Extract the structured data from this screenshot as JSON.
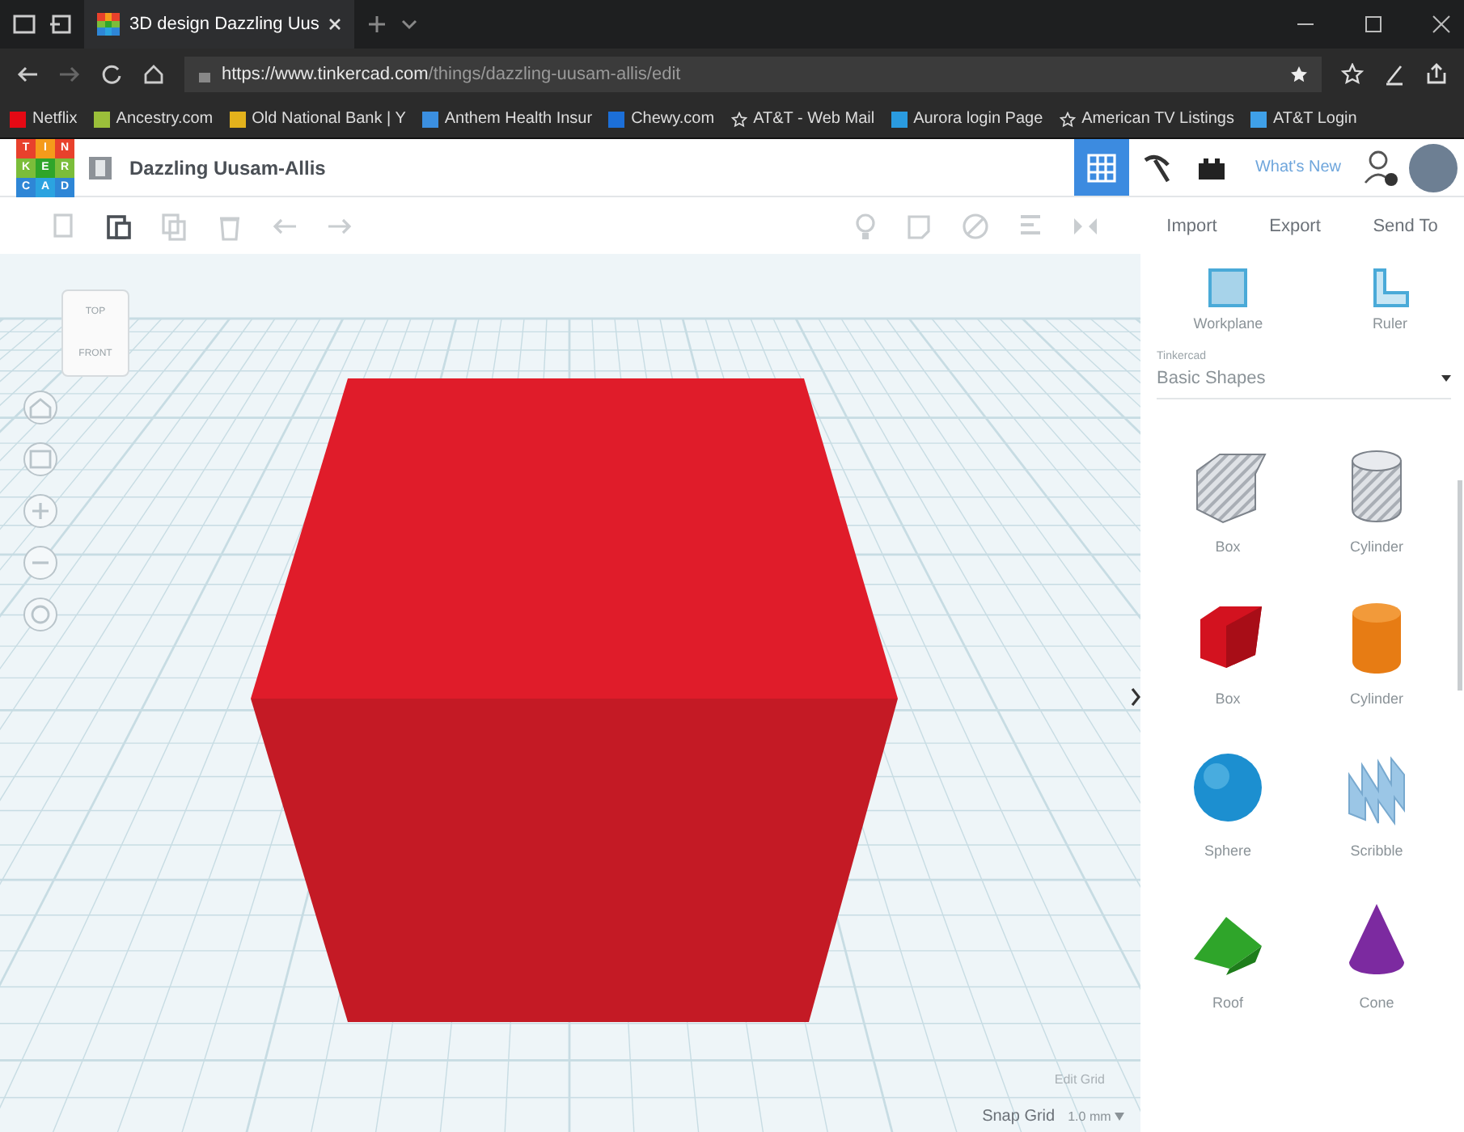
{
  "browser": {
    "tab_title": "3D design Dazzling Uus",
    "url_host": "https://www.tinkercad.com",
    "url_path": "/things/dazzling-uusam-allis/edit",
    "bookmarks": [
      {
        "label": "Netflix",
        "kind": "favicon",
        "color": "#e50914"
      },
      {
        "label": "Ancestry.com",
        "kind": "favicon",
        "color": "#9bbf3a"
      },
      {
        "label": "Old National Bank | Y",
        "kind": "favicon",
        "color": "#e3b21c"
      },
      {
        "label": "Anthem Health Insur",
        "kind": "favicon",
        "color": "#3b8fe0"
      },
      {
        "label": "Chewy.com",
        "kind": "favicon",
        "color": "#1c6fd8"
      },
      {
        "label": "AT&T - Web Mail",
        "kind": "star"
      },
      {
        "label": "Aurora login Page",
        "kind": "favicon",
        "color": "#2a9be0"
      },
      {
        "label": "American TV Listings",
        "kind": "star"
      },
      {
        "label": "AT&T Login",
        "kind": "favicon",
        "color": "#3fa0e8"
      }
    ]
  },
  "app": {
    "logo": [
      "T",
      "I",
      "N",
      "K",
      "E",
      "R",
      "C",
      "A",
      "D"
    ],
    "design_name": "Dazzling Uusam-Allis",
    "view_modes": [
      {
        "kind": "grid",
        "selected": true
      },
      {
        "kind": "pickaxe",
        "selected": false
      },
      {
        "kind": "bricks",
        "selected": false
      }
    ],
    "whats_new": "What's New",
    "tools": [
      {
        "kind": "copy",
        "disabled": true
      },
      {
        "kind": "paste",
        "disabled": false
      },
      {
        "kind": "duplicate",
        "disabled": true
      },
      {
        "kind": "delete",
        "disabled": true
      },
      {
        "kind": "undo",
        "disabled": true
      },
      {
        "kind": "redo",
        "disabled": true
      }
    ],
    "shape_tools": [
      {
        "kind": "bulb",
        "disabled": true
      },
      {
        "kind": "note",
        "disabled": true
      },
      {
        "kind": "ring",
        "disabled": true
      },
      {
        "kind": "align",
        "disabled": true
      },
      {
        "kind": "mirror",
        "disabled": true
      }
    ],
    "actions": [
      "Import",
      "Export",
      "Send To"
    ]
  },
  "canvas": {
    "view_cube": {
      "top": "TOP",
      "front": "FRONT"
    },
    "edit_grid": "Edit Grid",
    "snap_label": "Snap Grid",
    "snap_value": "1.0 mm"
  },
  "panel": {
    "tools": [
      {
        "kind": "workplane",
        "label": "Workplane"
      },
      {
        "kind": "ruler",
        "label": "Ruler"
      }
    ],
    "library_caption": "Tinkercad",
    "library": "Basic Shapes",
    "shapes": [
      {
        "kind": "box-hole",
        "label": "Box"
      },
      {
        "kind": "cylinder-hole",
        "label": "Cylinder"
      },
      {
        "kind": "box",
        "label": "Box"
      },
      {
        "kind": "cylinder",
        "label": "Cylinder"
      },
      {
        "kind": "sphere",
        "label": "Sphere"
      },
      {
        "kind": "scribble",
        "label": "Scribble"
      },
      {
        "kind": "roof",
        "label": "Roof"
      },
      {
        "kind": "cone",
        "label": "Cone"
      }
    ]
  }
}
